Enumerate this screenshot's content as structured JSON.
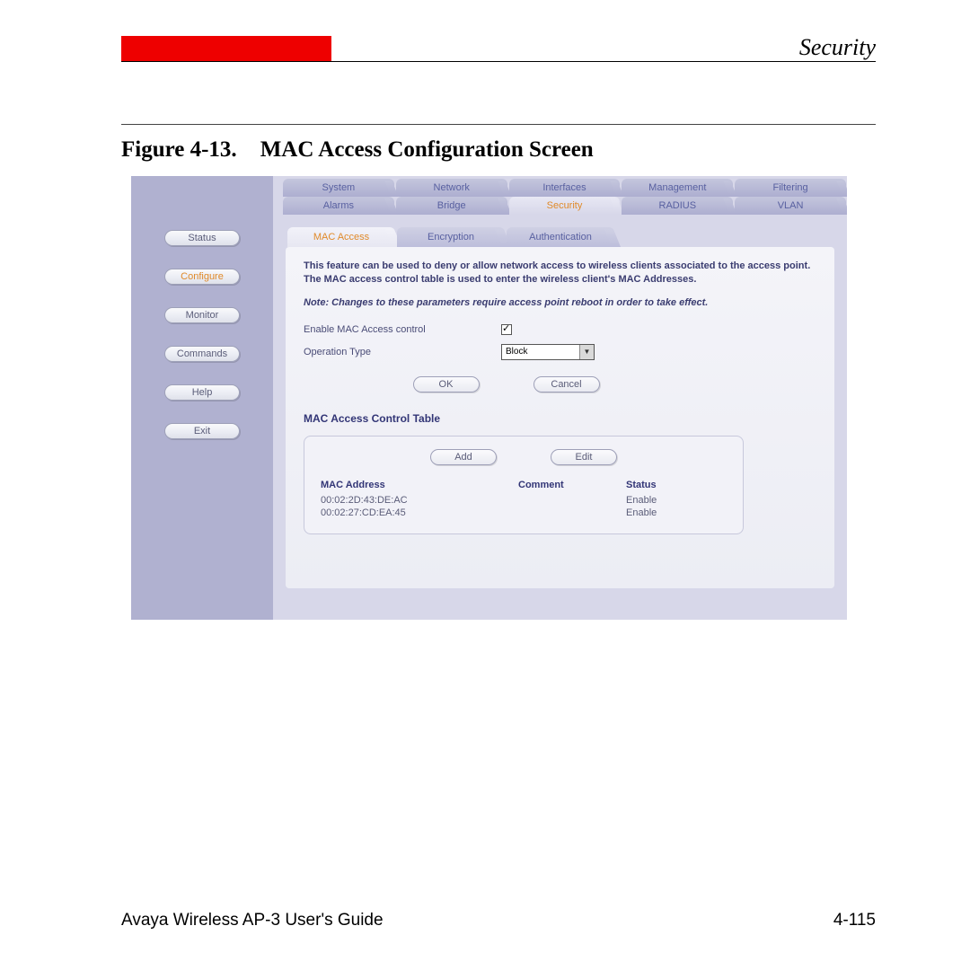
{
  "header": {
    "title": "Security"
  },
  "figure": {
    "number": "Figure 4-13.",
    "title": "MAC Access Configuration Screen"
  },
  "sidebar": {
    "items": [
      {
        "label": "Status",
        "active": false
      },
      {
        "label": "Configure",
        "active": true
      },
      {
        "label": "Monitor",
        "active": false
      },
      {
        "label": "Commands",
        "active": false
      },
      {
        "label": "Help",
        "active": false
      },
      {
        "label": "Exit",
        "active": false
      }
    ]
  },
  "top_tabs": {
    "row1": [
      "System",
      "Network",
      "Interfaces",
      "Management",
      "Filtering"
    ],
    "row2": [
      "Alarms",
      "Bridge",
      "Security",
      "RADIUS",
      "VLAN"
    ],
    "active_row2": "Security"
  },
  "sub_tabs": {
    "items": [
      "MAC Access",
      "Encryption",
      "Authentication"
    ],
    "active": "MAC Access"
  },
  "content": {
    "description": "This feature can be used to deny or allow network access to wireless clients associated to the access point. The MAC access control table is used to enter the wireless client's MAC Addresses.",
    "note": "Note: Changes to these parameters require access point reboot in order to take effect.",
    "enable_label": "Enable MAC Access control",
    "enable_checked": true,
    "operation_label": "Operation Type",
    "operation_value": "Block",
    "ok_label": "OK",
    "cancel_label": "Cancel",
    "table_title": "MAC Access Control Table",
    "add_label": "Add",
    "edit_label": "Edit",
    "table": {
      "headers": {
        "mac": "MAC Address",
        "comment": "Comment",
        "status": "Status"
      },
      "rows": [
        {
          "mac": "00:02:2D:43:DE:AC",
          "comment": "",
          "status": "Enable"
        },
        {
          "mac": "00:02:27:CD:EA:45",
          "comment": "",
          "status": "Enable"
        }
      ]
    }
  },
  "footer": {
    "left": "Avaya Wireless AP-3 User's Guide",
    "right": "4-115"
  }
}
